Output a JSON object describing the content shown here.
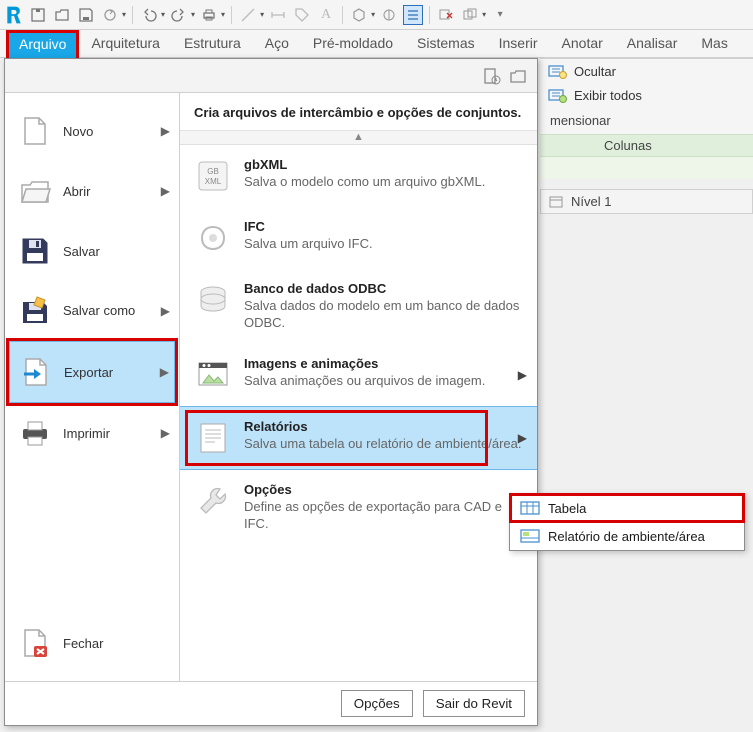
{
  "ribbon_tabs": {
    "active": "Arquivo",
    "arquitetura": "Arquitetura",
    "estrutura": "Estrutura",
    "aco": "Aço",
    "premold": "Pré-moldado",
    "sistemas": "Sistemas",
    "inserir": "Inserir",
    "anotar": "Anotar",
    "analisar": "Analisar",
    "mas": "Mas"
  },
  "right_panel": {
    "ocultar": "Ocultar",
    "exibir_todos": "Exibir todos",
    "mensionar": "mensionar",
    "colunas": "Colunas",
    "nivel": "Nível 1"
  },
  "appmenu": {
    "header": "Cria arquivos de intercâmbio e opções de conjuntos.",
    "left": {
      "novo": "Novo",
      "abrir": "Abrir",
      "salvar": "Salvar",
      "salvar_como": "Salvar como",
      "exportar": "Exportar",
      "imprimir": "Imprimir",
      "fechar": "Fechar"
    },
    "right": {
      "gbxml": {
        "t": "gbXML",
        "d": "Salva o modelo como um arquivo gbXML."
      },
      "ifc": {
        "t": "IFC",
        "d": "Salva um arquivo IFC."
      },
      "odbc": {
        "t": "Banco de dados ODBC",
        "d": "Salva dados do modelo em um banco de dados ODBC."
      },
      "img": {
        "t": "Imagens e animações",
        "d": "Salva animações ou arquivos de imagem."
      },
      "rel": {
        "t": "Relatórios",
        "d": "Salva uma tabela ou relatório de ambiente/área."
      },
      "opc": {
        "t": "Opções",
        "d": "Define as opções de exportação para CAD e IFC."
      }
    },
    "footer": {
      "opcoes": "Opções",
      "sair": "Sair do Revit"
    }
  },
  "submenu": {
    "tabela": "Tabela",
    "relamb": "Relatório de ambiente/área"
  }
}
